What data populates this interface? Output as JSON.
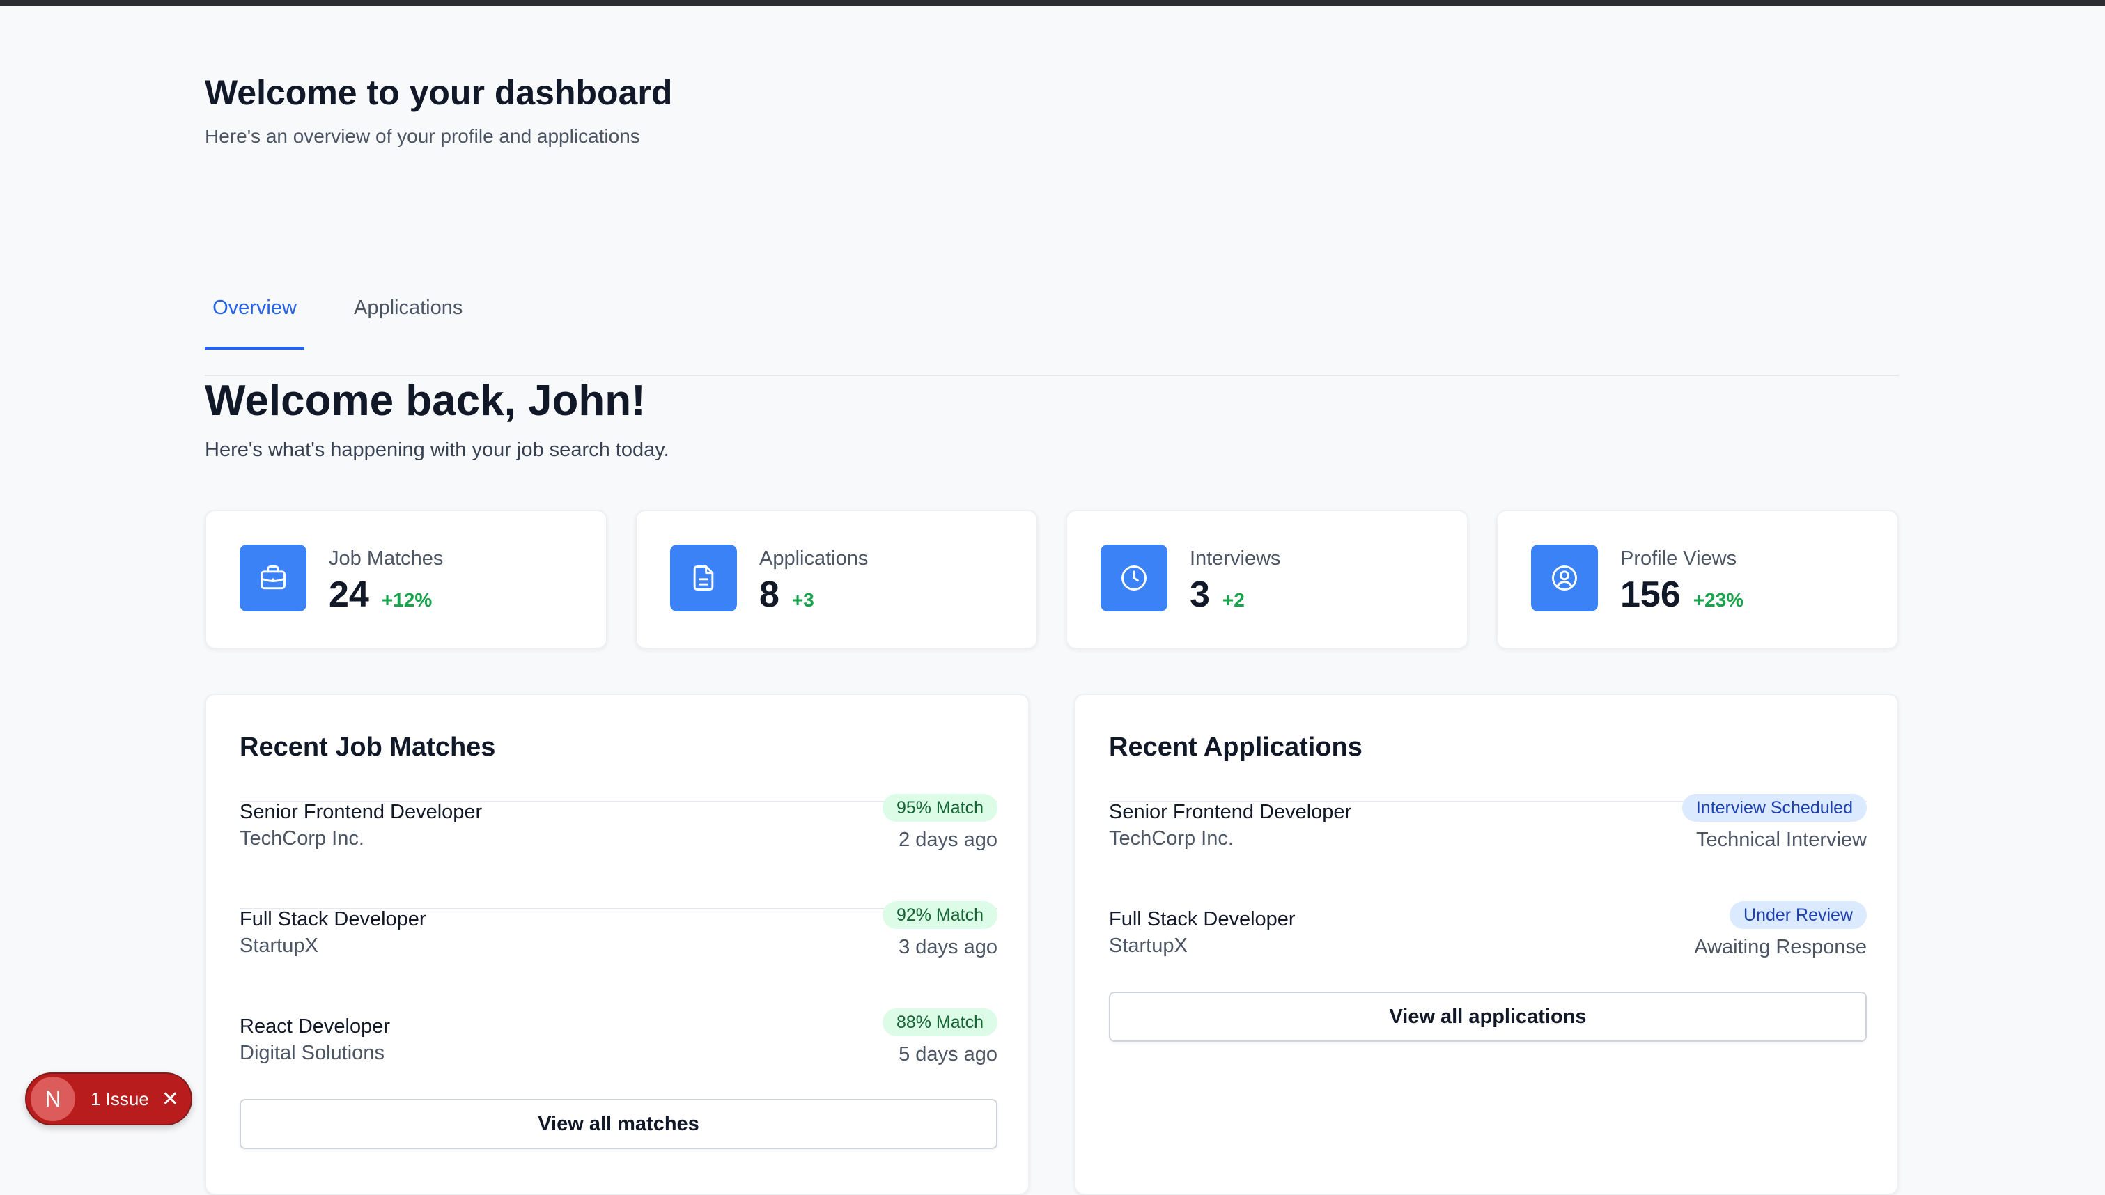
{
  "header": {
    "title": "Welcome to your dashboard",
    "subtitle": "Here's an overview of your profile and applications"
  },
  "tabs": [
    {
      "label": "Overview",
      "active": true
    },
    {
      "label": "Applications",
      "active": false
    }
  ],
  "welcome": {
    "title": "Welcome back, John!",
    "subtitle": "Here's what's happening with your job search today."
  },
  "stats": [
    {
      "icon": "briefcase-icon",
      "label": "Job Matches",
      "value": "24",
      "delta": "+12%"
    },
    {
      "icon": "document-icon",
      "label": "Applications",
      "value": "8",
      "delta": "+3"
    },
    {
      "icon": "clock-icon",
      "label": "Interviews",
      "value": "3",
      "delta": "+2"
    },
    {
      "icon": "user-circle-icon",
      "label": "Profile Views",
      "value": "156",
      "delta": "+23%"
    }
  ],
  "recent_matches": {
    "title": "Recent Job Matches",
    "items": [
      {
        "title": "Senior Frontend Developer",
        "company": "TechCorp Inc.",
        "badge": "95% Match",
        "meta": "2 days ago"
      },
      {
        "title": "Full Stack Developer",
        "company": "StartupX",
        "badge": "92% Match",
        "meta": "3 days ago"
      },
      {
        "title": "React Developer",
        "company": "Digital Solutions",
        "badge": "88% Match",
        "meta": "5 days ago"
      }
    ],
    "button": "View all matches"
  },
  "recent_applications": {
    "title": "Recent Applications",
    "items": [
      {
        "title": "Senior Frontend Developer",
        "company": "TechCorp Inc.",
        "badge": "Interview Scheduled",
        "meta": "Technical Interview"
      },
      {
        "title": "Full Stack Developer",
        "company": "StartupX",
        "badge": "Under Review",
        "meta": "Awaiting Response"
      }
    ],
    "button": "View all applications"
  },
  "issue_indicator": {
    "letter": "N",
    "text": "1 Issue",
    "close": "✕"
  },
  "colors": {
    "accent": "#3b82f6",
    "positive": "#16a34a",
    "match_badge_bg": "#dcfce7",
    "status_badge_bg": "#dbeafe",
    "issue_bg": "#b91c1c"
  }
}
